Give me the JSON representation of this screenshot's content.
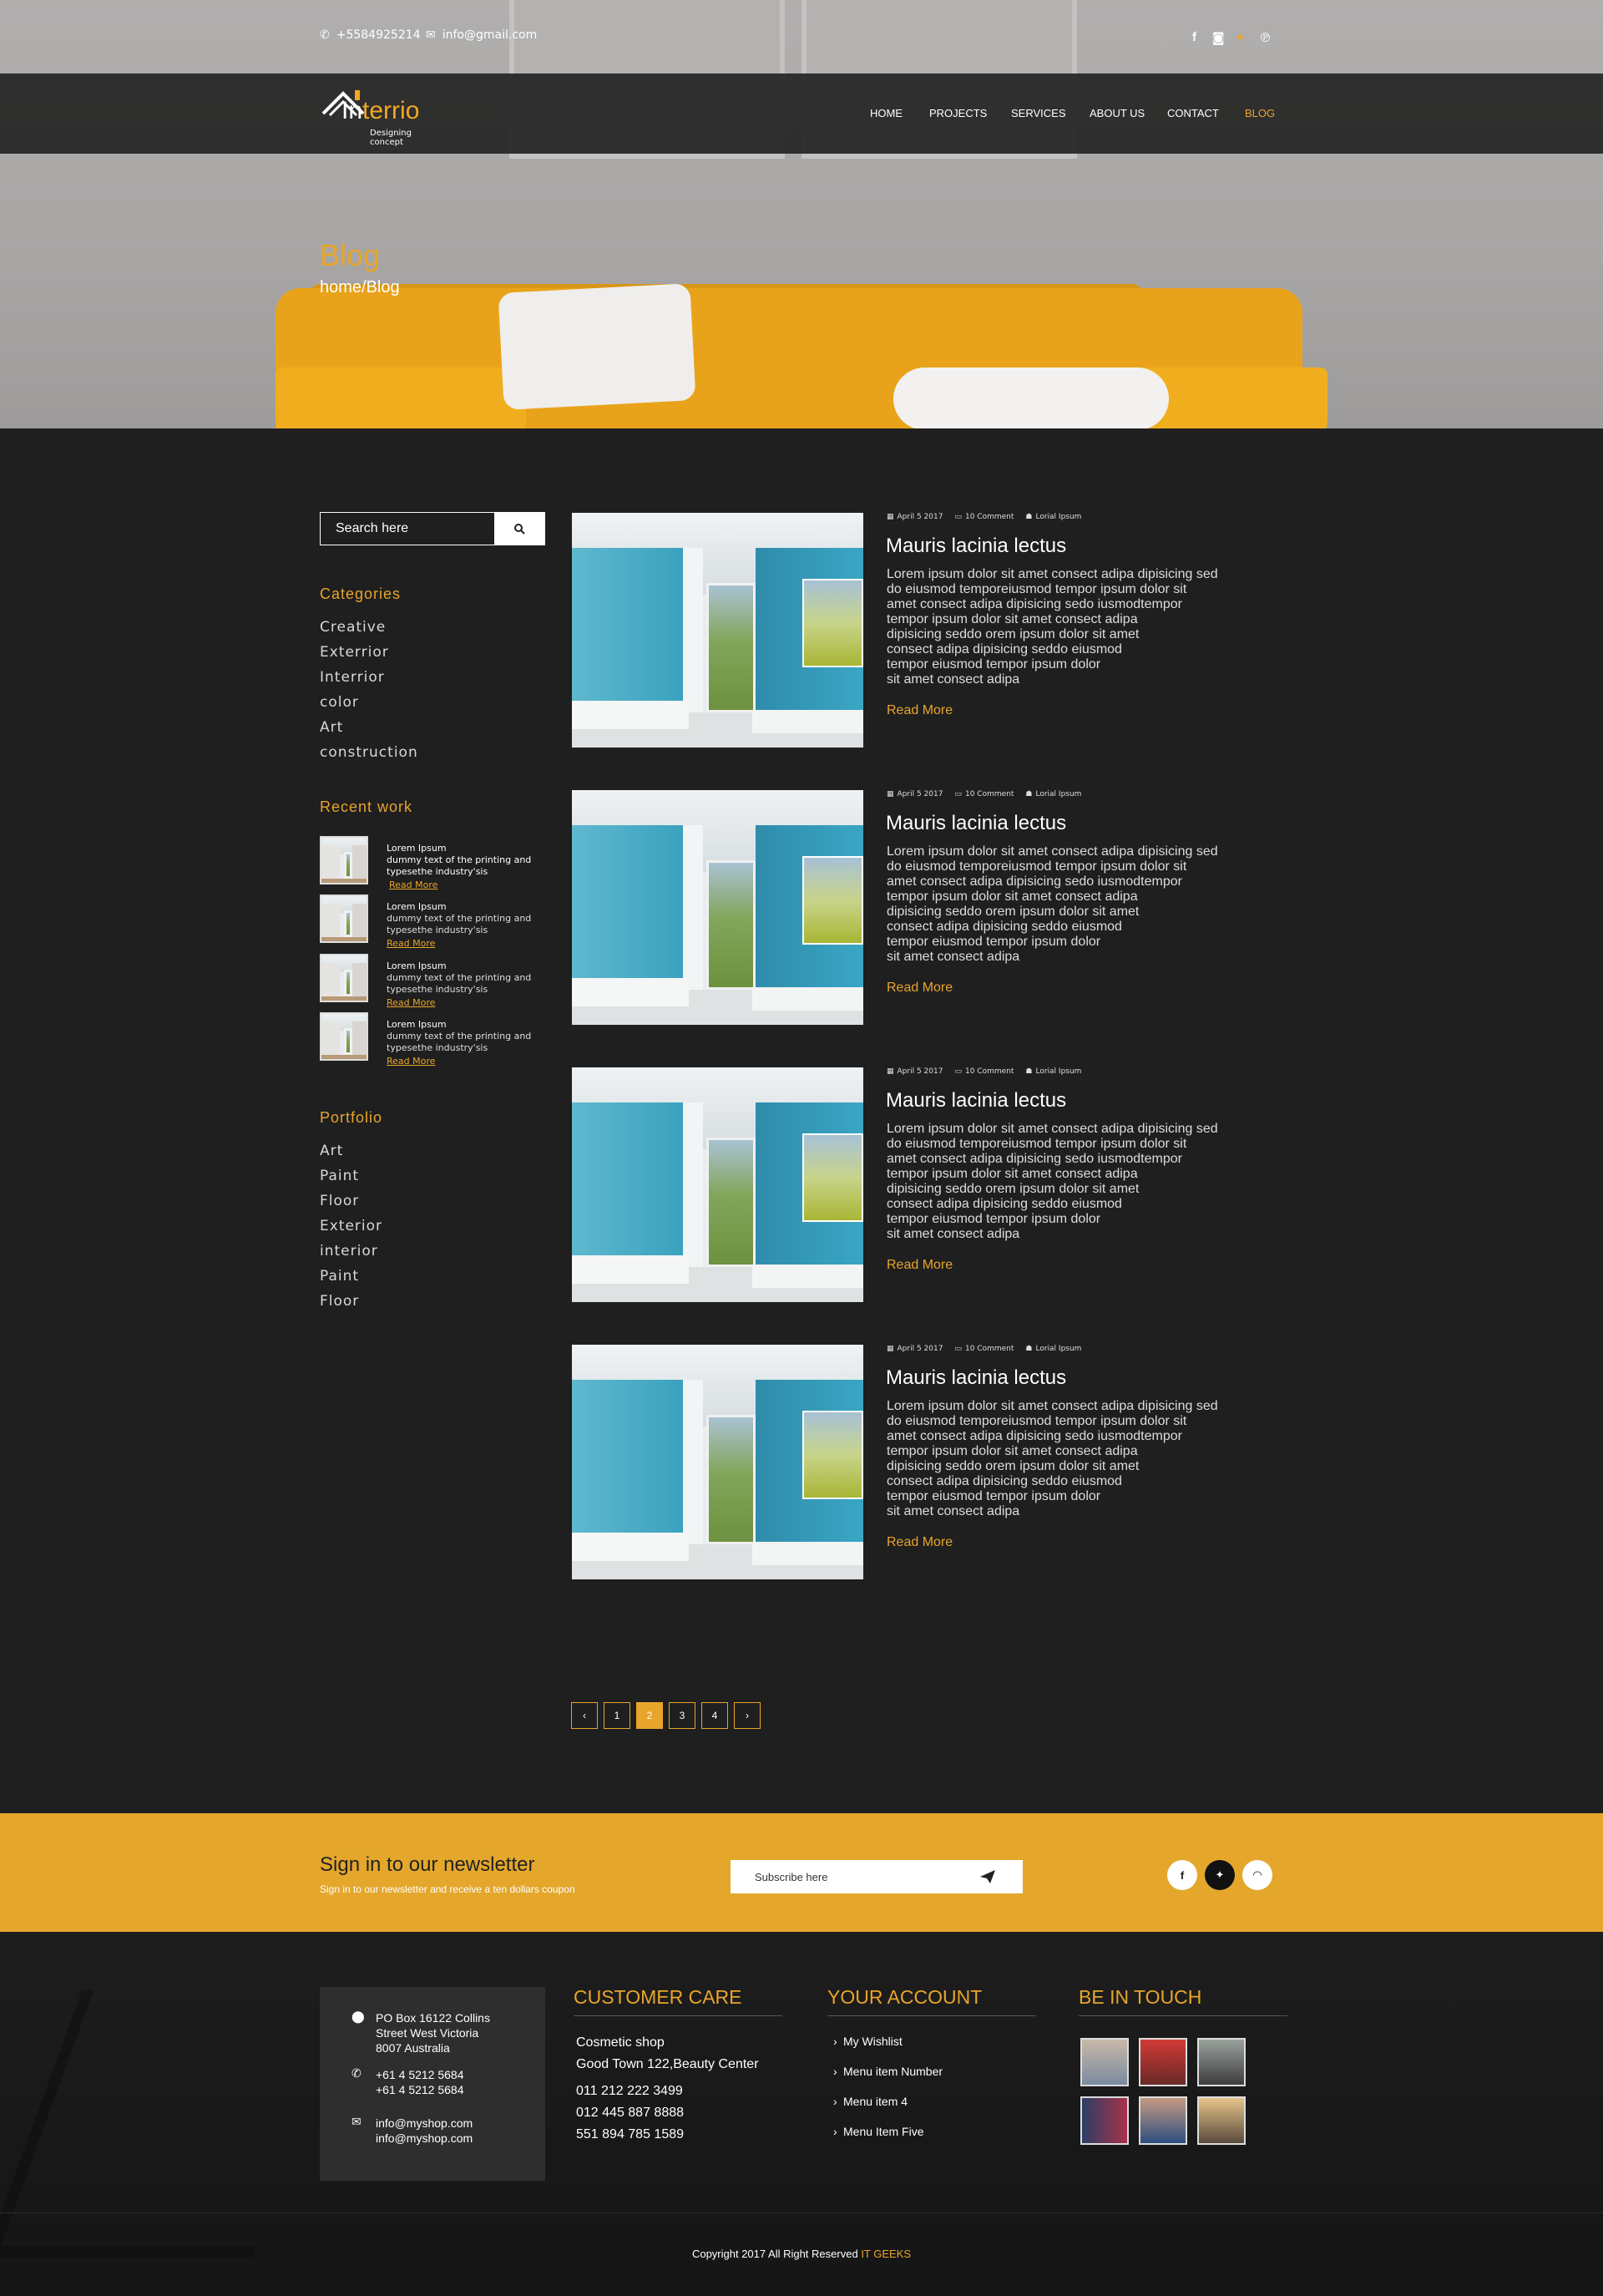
{
  "header": {
    "phone": "+5584925214",
    "email": "info@gmail.com",
    "social": [
      "facebook-icon",
      "instagram-icon",
      "twitter-icon",
      "pinterest-icon"
    ],
    "logo_text_a": "In",
    "logo_text_b": "terrio",
    "logo_tagline": "Designing concept",
    "nav": [
      "HOME",
      "PROJECTS",
      "SERVICES",
      "ABOUT US",
      "CONTACT",
      "BLOG"
    ],
    "active_nav": "BLOG",
    "page_title": "Blog",
    "breadcrumb": "home/Blog"
  },
  "sidebar": {
    "search_placeholder": "Search here",
    "categories_title": "Categories",
    "categories": [
      "Creative",
      "Exterrior",
      "Interrior",
      "color",
      "Art",
      "construction"
    ],
    "recent_title": "Recent work",
    "recent": [
      {
        "title": "Lorem Ipsum",
        "text": "dummy text of the printing and typesethe industry'sis",
        "more": "Read More"
      },
      {
        "title": "Lorem Ipsum",
        "text": "dummy text of the printing and typesethe industry'sis",
        "more": "Read More"
      },
      {
        "title": "Lorem Ipsum",
        "text": "dummy text of the printing and typesethe industry'sis",
        "more": "Read More"
      },
      {
        "title": "Lorem Ipsum",
        "text": "dummy text of the printing and typesethe industry'sis",
        "more": "Read More"
      }
    ],
    "portfolio_title": "Portfolio",
    "portfolio": [
      "Art",
      "Paint",
      "Floor",
      "Exterior",
      "interior",
      "Paint",
      "Floor"
    ]
  },
  "posts": [
    {
      "date": "April 5 2017",
      "comments": "10 Comment",
      "author": "Lorial Ipsum",
      "title": "Mauris lacinia lectus",
      "body": "Lorem ipsum dolor sit amet consect adipa dipisicing sed\ndo eiusmod temporeiusmod tempor ipsum dolor sit\namet consect adipa dipisicing sedo iusmodtempor\ntempor ipsum dolor sit amet consect adipa\ndipisicing seddo orem ipsum dolor sit amet\n consect adipa dipisicing seddo eiusmod\ntempor eiusmod tempor ipsum dolor\nsit amet consect adipa",
      "more": "Read More"
    },
    {
      "date": "April 5 2017",
      "comments": "10 Comment",
      "author": "Lorial Ipsum",
      "title": "Mauris lacinia lectus",
      "body": "Lorem ipsum dolor sit amet consect adipa dipisicing sed\ndo eiusmod temporeiusmod tempor ipsum dolor sit\namet consect adipa dipisicing sedo iusmodtempor\ntempor ipsum dolor sit amet consect adipa\ndipisicing seddo orem ipsum dolor sit amet\n consect adipa dipisicing seddo eiusmod\ntempor eiusmod tempor ipsum dolor\nsit amet consect adipa",
      "more": "Read More"
    },
    {
      "date": "April 5 2017",
      "comments": "10 Comment",
      "author": "Lorial Ipsum",
      "title": "Mauris lacinia lectus",
      "body": "Lorem ipsum dolor sit amet consect adipa dipisicing sed\ndo eiusmod temporeiusmod tempor ipsum dolor sit\namet consect adipa dipisicing sedo iusmodtempor\ntempor ipsum dolor sit amet consect adipa\ndipisicing seddo orem ipsum dolor sit amet\n consect adipa dipisicing seddo eiusmod\ntempor eiusmod tempor ipsum dolor\nsit amet consect adipa",
      "more": "Read More"
    },
    {
      "date": "April 5 2017",
      "comments": "10 Comment",
      "author": "Lorial Ipsum",
      "title": "Mauris lacinia lectus",
      "body": "Lorem ipsum dolor sit amet consect adipa dipisicing sed\ndo eiusmod temporeiusmod tempor ipsum dolor sit\namet consect adipa dipisicing sedo iusmodtempor\ntempor ipsum dolor sit amet consect adipa\ndipisicing seddo orem ipsum dolor sit amet\n consect adipa dipisicing seddo eiusmod\ntempor eiusmod tempor ipsum dolor\nsit amet consect adipa",
      "more": "Read More"
    }
  ],
  "pagination": {
    "pages": [
      "1",
      "2",
      "3",
      "4"
    ],
    "active": "2",
    "prev": "‹",
    "next": "›"
  },
  "newsletter": {
    "title": "Sign in to our newsletter",
    "subtitle": "Sign in to our newsletter and receive a ten  dollars coupon",
    "placeholder": "Subscribe here",
    "social": [
      "facebook-icon",
      "twitter-icon",
      "rss-icon"
    ]
  },
  "footer": {
    "address": "PO Box 16122 Collins\nStreet West Victoria\n 8007 Australia",
    "phones": "+61 4 5212 5684\n+61 4 5212 5684",
    "emails": "info@myshop.com\ninfo@myshop.com",
    "care_title": "CUSTOMER CARE",
    "care_lines": [
      "Cosmetic shop",
      "Good Town 122,Beauty Center",
      "011 212 222 3499",
      "012 445 887 8888",
      "551 894 785 1589"
    ],
    "account_title": "YOUR ACCOUNT",
    "account_links": [
      "My Wishlist",
      "Menu item Number",
      "Menu item 4",
      "Menu Item Five"
    ],
    "touch_title": "BE IN TOUCH",
    "copyright": "Copyright 2017  All Right Reserved",
    "brand": "IT GEEKS"
  },
  "colors": {
    "accent": "#e8a52b",
    "dark": "#1f1f1f",
    "newsletter": "#e4a72c"
  }
}
